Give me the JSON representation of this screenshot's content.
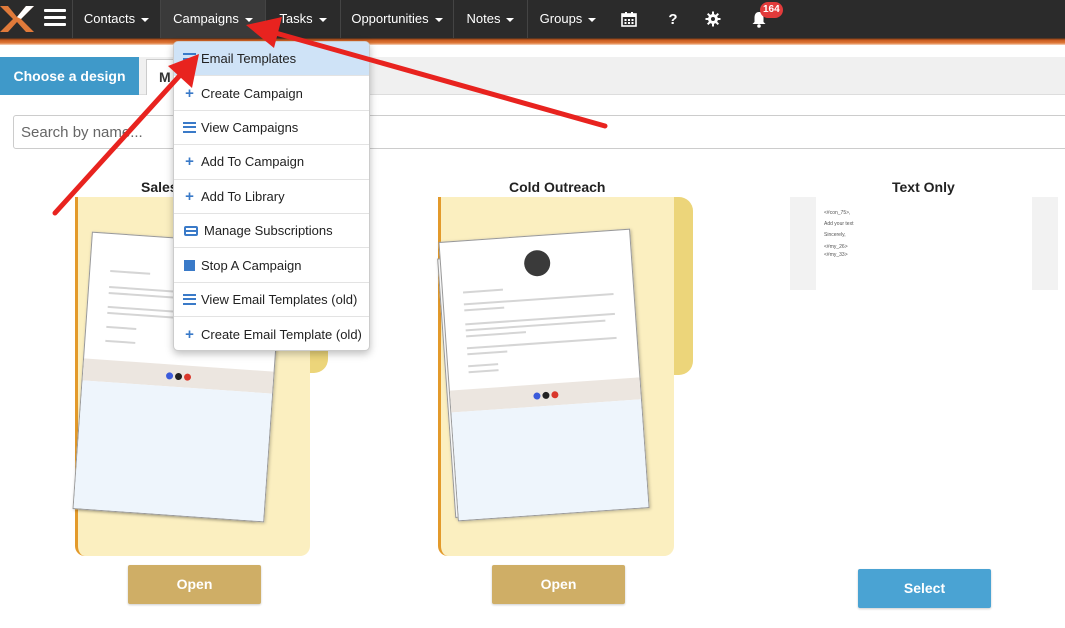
{
  "nav": {
    "items": [
      {
        "label": "Contacts"
      },
      {
        "label": "Campaigns"
      },
      {
        "label": "Tasks"
      },
      {
        "label": "Opportunities"
      },
      {
        "label": "Notes"
      },
      {
        "label": "Groups"
      }
    ],
    "icons": [
      "calendar-icon",
      "help-icon",
      "gear-icon",
      "bell-icon"
    ],
    "notification_count": "164"
  },
  "tabs": {
    "active": "Choose a design",
    "second": "M"
  },
  "search": {
    "placeholder": "Search by name..."
  },
  "cards": [
    {
      "title": "Sales",
      "button": "Open"
    },
    {
      "title": "Cold Outreach",
      "button": "Open"
    },
    {
      "title": "Text Only",
      "button": "Select"
    }
  ],
  "text_only_preview": {
    "lines": [
      "<#con_75>,",
      "Add your text",
      "Sincerely,",
      "<#my_26>",
      "<#my_33>"
    ]
  },
  "dropdown": {
    "items": [
      {
        "label": "Email Templates",
        "icon": "list-icon"
      },
      {
        "label": "Create Campaign",
        "icon": "plus-icon"
      },
      {
        "label": "View Campaigns",
        "icon": "list-icon"
      },
      {
        "label": "Add To Campaign",
        "icon": "plus-icon"
      },
      {
        "label": "Add To Library",
        "icon": "plus-icon"
      },
      {
        "label": "Manage Subscriptions",
        "icon": "card-icon"
      },
      {
        "label": "Stop A Campaign",
        "icon": "stop-icon"
      },
      {
        "label": "View Email Templates (old)",
        "icon": "list-icon"
      },
      {
        "label": "Create Email Template (old)",
        "icon": "plus-icon"
      }
    ]
  },
  "colors": {
    "topbar": "#2b2b2b",
    "accent_orange": "#e07a3a",
    "tab_blue": "#3f99c9",
    "open_button": "#cfae66",
    "select_button": "#4aa3d3",
    "annotation_arrow": "#e8231f"
  }
}
